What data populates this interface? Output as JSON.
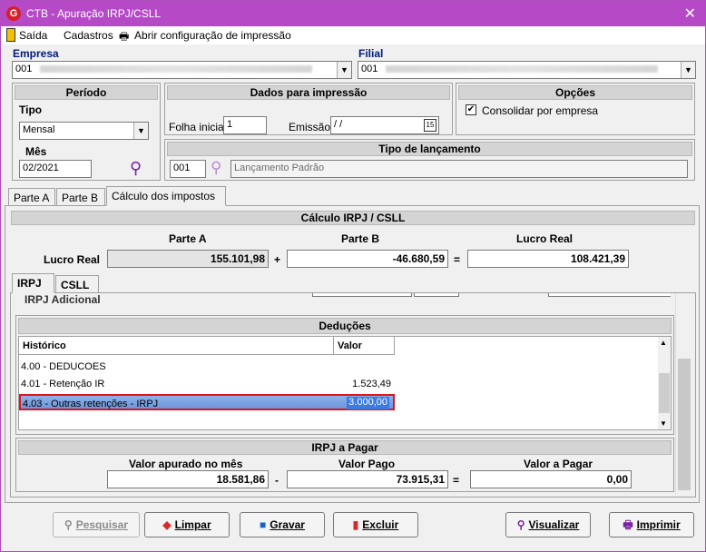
{
  "window": {
    "title": "CTB - Apuração IRPJ/CSLL",
    "close": "✕"
  },
  "menu": {
    "saida": "Saída",
    "cadastros": "Cadastros",
    "print_config": "Abrir configuração de impressão"
  },
  "empresa": {
    "label": "Empresa",
    "value": "001 "
  },
  "filial": {
    "label": "Filial",
    "value": "001 "
  },
  "periodo": {
    "header": "Período",
    "tipo_label": "Tipo",
    "tipo_value": "Mensal",
    "mes_label": "Mês",
    "mes_value": "02/2021"
  },
  "dados_impressao": {
    "header": "Dados para impressão",
    "folha_label": "Folha inicial",
    "folha_value": "1",
    "emissao_label": "Emissão",
    "emissao_value": " /  /",
    "cal_icon": "15"
  },
  "opcoes": {
    "header": "Opções",
    "consolidar_label": "Consolidar por empresa",
    "consolidar_checked": "✔"
  },
  "tipo_lancamento": {
    "header": "Tipo de lançamento",
    "code": "001",
    "desc": "Lançamento Padrão"
  },
  "tabs": [
    "Parte A",
    "Parte B",
    "Cálculo dos impostos"
  ],
  "calculo": {
    "header": "Cálculo IRPJ / CSLL",
    "col_a": "Parte A",
    "col_b": "Parte B",
    "col_lucro": "Lucro Real",
    "row_label": "Lucro Real",
    "parte_a": "155.101,98",
    "plus": "+",
    "parte_b": "-46.680,59",
    "eq": "=",
    "lucro_real": "108.421,39"
  },
  "subtabs": [
    "IRPJ",
    "CSLL"
  ],
  "irpj_adicional_label": "IRPJ Adicional",
  "deducoes": {
    "header": "Deduções",
    "col_historico": "Histórico",
    "col_valor": "Valor",
    "rows": [
      {
        "historico": "4.00 - DEDUCOES",
        "valor": ""
      },
      {
        "historico": "4.01 - Retenção IR",
        "valor": "1.523,49"
      },
      {
        "historico": "4.03 - Outras retenções - IRPJ",
        "valor": "3.000,00"
      }
    ]
  },
  "irpj_pagar": {
    "header": "IRPJ a Pagar",
    "col_apurado": "Valor apurado no mês",
    "col_pago": "Valor Pago",
    "col_pagar": "Valor a Pagar",
    "apurado": "18.581,86",
    "minus": "-",
    "pago": "73.915,31",
    "eq": "=",
    "a_pagar": "0,00"
  },
  "buttons": {
    "pesquisar": "Pesquisar",
    "limpar": "Limpar",
    "gravar": "Gravar",
    "excluir": "Excluir",
    "visualizar": "Visualizar",
    "imprimir": "Imprimir"
  },
  "colors": {
    "titlebar": "#b549c6",
    "accent_label": "#001a7a",
    "selection": "#3d7be0",
    "highlight_border": "#e0141e"
  }
}
